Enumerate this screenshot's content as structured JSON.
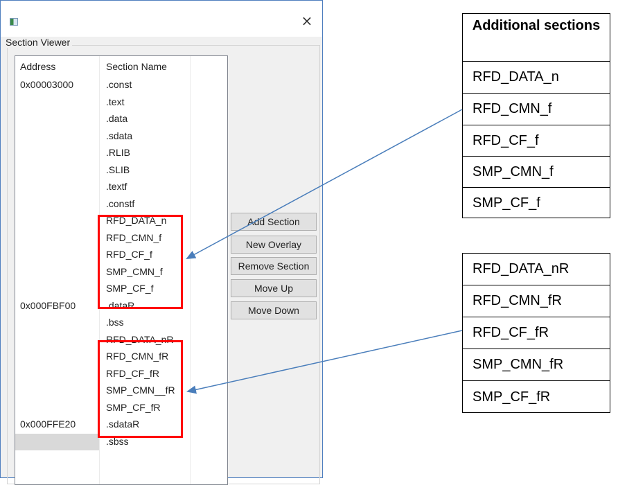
{
  "dialog": {
    "close_symbol": "×",
    "group_label": "Section Viewer"
  },
  "list": {
    "headers": {
      "address": "Address",
      "section_name": "Section Name"
    },
    "rows": [
      {
        "address": "0x00003000",
        "name": ".const"
      },
      {
        "address": "",
        "name": ".text"
      },
      {
        "address": "",
        "name": ".data"
      },
      {
        "address": "",
        "name": ".sdata"
      },
      {
        "address": "",
        "name": ".RLIB"
      },
      {
        "address": "",
        "name": ".SLIB"
      },
      {
        "address": "",
        "name": ".textf"
      },
      {
        "address": "",
        "name": ".constf"
      },
      {
        "address": "",
        "name": "RFD_DATA_n"
      },
      {
        "address": "",
        "name": "RFD_CMN_f"
      },
      {
        "address": "",
        "name": "RFD_CF_f"
      },
      {
        "address": "",
        "name": "SMP_CMN_f"
      },
      {
        "address": "",
        "name": "SMP_CF_f"
      },
      {
        "address": "0x000FBF00",
        "name": ".dataR"
      },
      {
        "address": "",
        "name": ".bss"
      },
      {
        "address": "",
        "name": "RFD_DATA_nR"
      },
      {
        "address": "",
        "name": "RFD_CMN_fR"
      },
      {
        "address": "",
        "name": "RFD_CF_fR"
      },
      {
        "address": "",
        "name": "SMP_CMN__fR"
      },
      {
        "address": "",
        "name": "SMP_CF_fR"
      },
      {
        "address": "0x000FFE20",
        "name": ".sdataR"
      },
      {
        "address": "",
        "name": ".sbss"
      }
    ]
  },
  "buttons": {
    "add_section": "Add Section",
    "new_overlay": "New Overlay",
    "remove_section": "Remove Section",
    "move_up": "Move Up",
    "move_down": "Move Down"
  },
  "additional_table": {
    "header": "Additional sections",
    "items": [
      "RFD_DATA_n",
      "RFD_CMN_f",
      "RFD_CF_f",
      "SMP_CMN_f",
      "SMP_CF_f"
    ]
  },
  "relocated_table": {
    "items": [
      "RFD_DATA_nR",
      "RFD_CMN_fR",
      "RFD_CF_fR",
      "SMP_CMN_fR",
      "SMP_CF_fR"
    ]
  },
  "colors": {
    "highlight": "#ff0000",
    "arrow": "#4a7ebb",
    "window_border": "#4f7fbf"
  }
}
